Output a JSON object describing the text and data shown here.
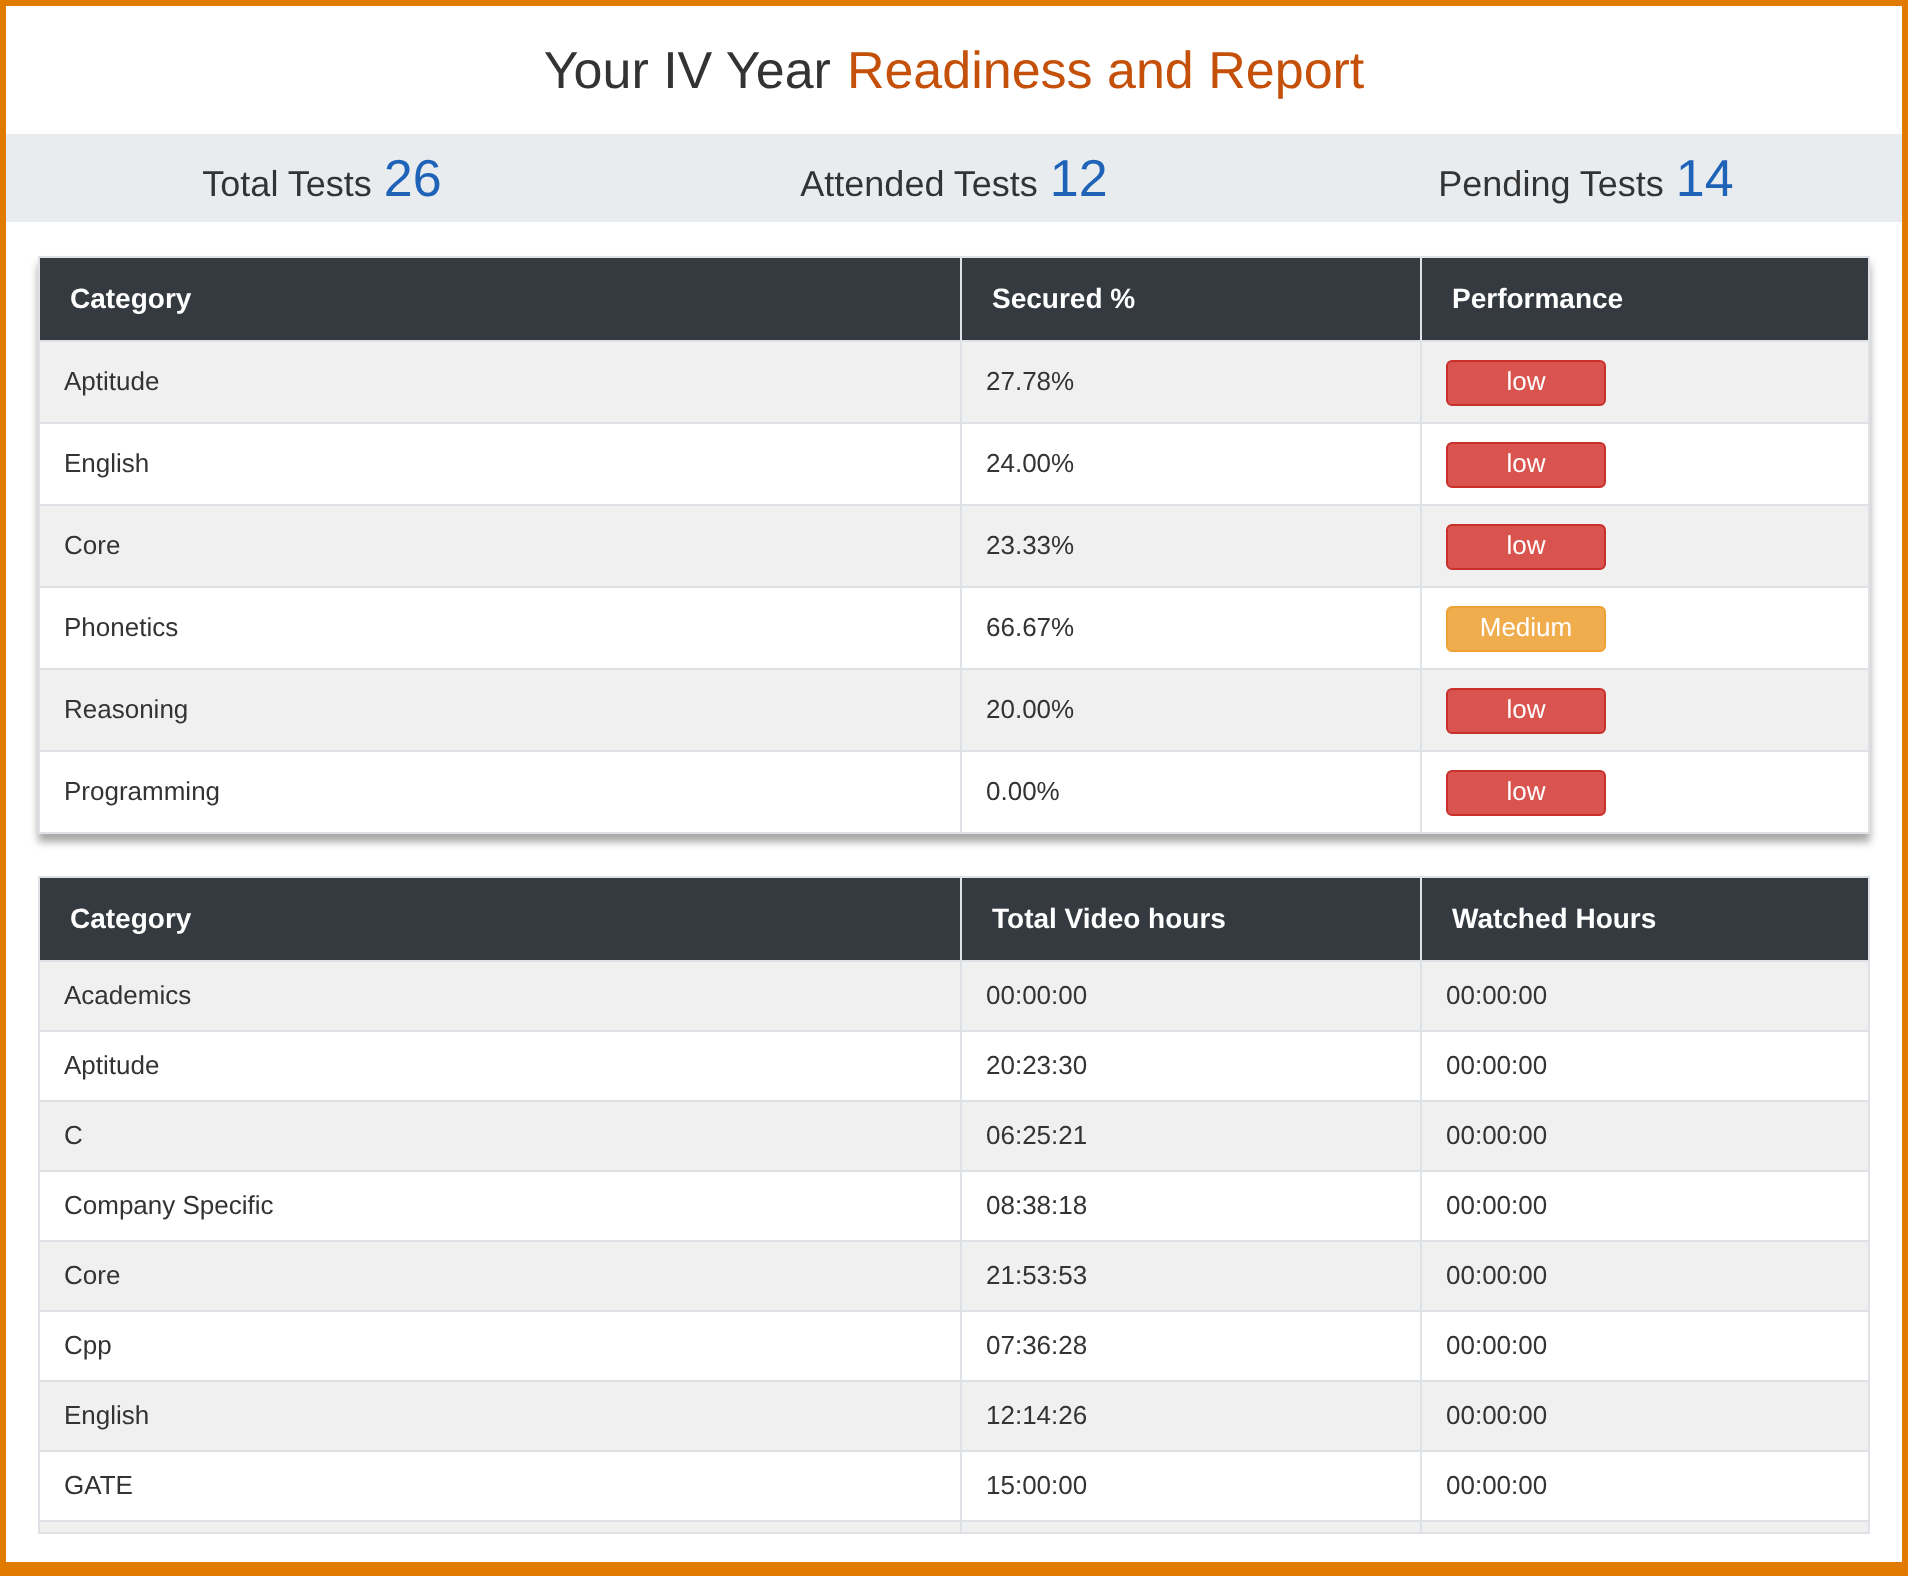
{
  "title": {
    "text": "Your IV Year",
    "highlight": "Readiness and Report"
  },
  "stats": [
    {
      "label": "Total Tests",
      "value": "26"
    },
    {
      "label": "Attended Tests",
      "value": "12"
    },
    {
      "label": "Pending Tests",
      "value": "14"
    }
  ],
  "performance_table": {
    "columns": [
      "Category",
      "Secured %",
      "Performance"
    ],
    "rows": [
      {
        "category": "Aptitude",
        "secured": "27.78%",
        "performance": {
          "text": "low",
          "kind": "low"
        }
      },
      {
        "category": "English",
        "secured": "24.00%",
        "performance": {
          "text": "low",
          "kind": "low"
        }
      },
      {
        "category": "Core",
        "secured": "23.33%",
        "performance": {
          "text": "low",
          "kind": "low"
        }
      },
      {
        "category": "Phonetics",
        "secured": "66.67%",
        "performance": {
          "text": "Medium",
          "kind": "medium"
        }
      },
      {
        "category": "Reasoning",
        "secured": "20.00%",
        "performance": {
          "text": "low",
          "kind": "low"
        }
      },
      {
        "category": "Programming",
        "secured": "0.00%",
        "performance": {
          "text": "low",
          "kind": "low"
        }
      }
    ]
  },
  "video_table": {
    "columns": [
      "Category",
      "Total Video hours",
      "Watched Hours"
    ],
    "rows": [
      [
        "Academics",
        "00:00:00",
        "00:00:00"
      ],
      [
        "Aptitude",
        "20:23:30",
        "00:00:00"
      ],
      [
        "C",
        "06:25:21",
        "00:00:00"
      ],
      [
        "Company Specific",
        "08:38:18",
        "00:00:00"
      ],
      [
        "Core",
        "21:53:53",
        "00:00:00"
      ],
      [
        "Cpp",
        "07:36:28",
        "00:00:00"
      ],
      [
        "English",
        "12:14:26",
        "00:00:00"
      ],
      [
        "GATE",
        "15:00:00",
        "00:00:00"
      ]
    ]
  }
}
